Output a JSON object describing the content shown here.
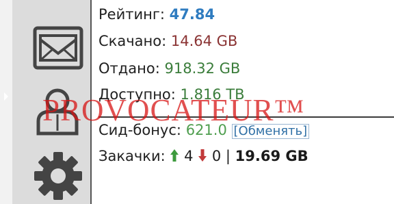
{
  "stats": {
    "rating": {
      "label": "Рейтинг:",
      "value": "47.84"
    },
    "downloaded": {
      "label": "Скачано:",
      "value": "14.64 GB"
    },
    "uploaded": {
      "label": "Отдано:",
      "value": "918.32 GB"
    },
    "available": {
      "label": "Доступно:",
      "value": "1.816 TB"
    },
    "seed_bonus": {
      "label": "Сид-бонус:",
      "value": "621.0",
      "exchange_label": "[Обменять]"
    },
    "downloads": {
      "label": "Закачки:",
      "up_count": "4",
      "down_count": "0",
      "separator": "|",
      "total": "19.69 GB"
    }
  },
  "sidebar": {
    "icons": [
      "mail-icon",
      "user-icon",
      "gear-icon"
    ]
  },
  "watermark": "PROVOCATEUR™",
  "colors": {
    "rating": "#2f7cc0",
    "downloaded": "#8a3333",
    "uploaded": "#3b7d3b",
    "bonus": "#4f9e4f",
    "link": "#2f6fa5",
    "up_arrow": "#3d9a3d",
    "down_arrow": "#c23a3a",
    "watermark": "#d71414"
  }
}
